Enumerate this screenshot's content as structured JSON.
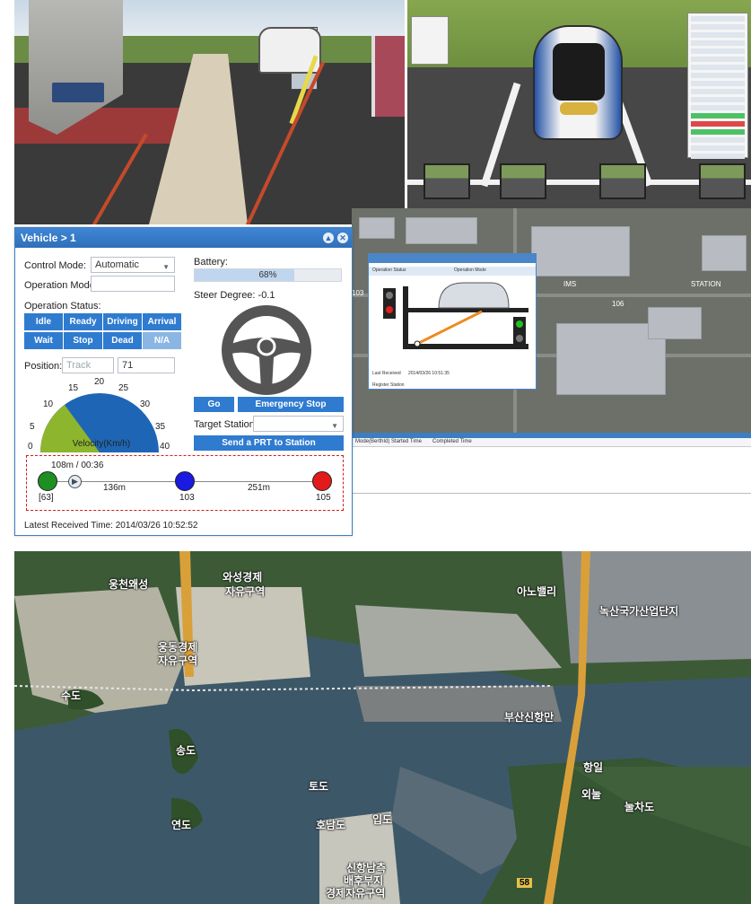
{
  "vehicle_panel": {
    "title": "Vehicle > 1",
    "control_mode_label": "Control Mode:",
    "control_mode_value": "Automatic",
    "operation_mode_label": "Operation Mode:",
    "operation_mode_value": "",
    "operation_status_label": "Operation Status:",
    "status_buttons": [
      "Idle",
      "Ready",
      "Driving",
      "Arrival",
      "Wait",
      "Stop",
      "Dead",
      "N/A"
    ],
    "position_label": "Position:",
    "position_placeholder": "Track",
    "position_value": "71",
    "battery_label": "Battery:",
    "battery_value": "68%",
    "battery_level": 0.68,
    "steer_label": "Steer Degree: -0.1",
    "go_label": "Go",
    "emergency_label": "Emergency Stop",
    "target_label": "Target Station:",
    "target_value": "",
    "send_label": "Send a PRT to Station",
    "gauge": {
      "ticks": [
        "0",
        "5",
        "10",
        "15",
        "20",
        "25",
        "30",
        "35",
        "40"
      ],
      "label": "Velocity(Km/h)"
    },
    "route": {
      "progress": "108m / 00:36",
      "start": "[63]",
      "seg1": "136m",
      "mid": "103",
      "seg2": "251m",
      "end": "105"
    },
    "latest": "Latest Received Time: 2014/03/26 10:52:52"
  },
  "sub_window": {
    "operation_status_label": "Operation Status",
    "operation_mode_label": "Operation Mode",
    "last_received": "Last Received",
    "last_received_value": "2014/03/26 10:51:35",
    "register_station": "Register Station"
  },
  "map_mid": {
    "labels": [
      "IMS",
      "STATION",
      "103",
      "106"
    ]
  },
  "bottom_strip": {
    "cols": [
      "Mode(BerthId)",
      "Started Time",
      "Completed Time"
    ]
  },
  "map_big": {
    "labels": [
      "웅천왜성",
      "와성경제",
      "자유구역",
      "웅동경제",
      "자유구역",
      "수도",
      "송도",
      "연도",
      "토도",
      "호남도",
      "입도",
      "신항남측",
      "배후부지",
      "경제자유구역",
      "부산신항만",
      "아노밸리",
      "녹산국가산업단지",
      "항일",
      "외눌",
      "눌차도",
      "58"
    ]
  },
  "colors": {
    "accent": "#2f7bd0",
    "gauge_green": "#8db52e",
    "gauge_blue": "#1e66b5",
    "node_green": "#1e8f22",
    "node_blue": "#1a1ae0",
    "node_red": "#e31a1a",
    "dashed_red": "#d31d1d"
  }
}
